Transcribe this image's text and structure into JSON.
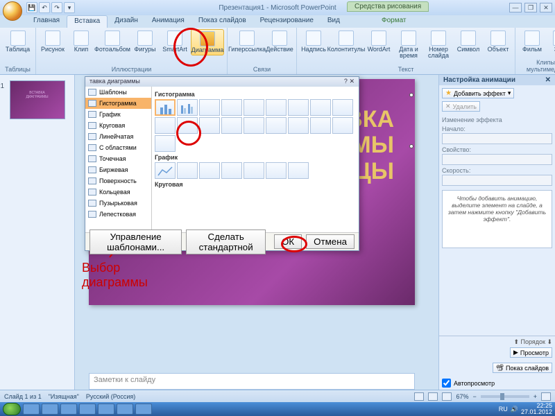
{
  "titlebar": {
    "title": "Презентация1 - Microsoft PowerPoint",
    "context_tab": "Средства рисования"
  },
  "tabs": {
    "home": "Главная",
    "insert": "Вставка",
    "design": "Дизайн",
    "anim": "Анимация",
    "show": "Показ слайдов",
    "review": "Рецензирование",
    "view": "Вид",
    "format": "Формат"
  },
  "ribbon": {
    "tables": {
      "btn": "Таблица",
      "group": "Таблицы"
    },
    "illus": {
      "picture": "Рисунок",
      "clip": "Клип",
      "album": "Фотоальбом",
      "shapes": "Фигуры",
      "smartart": "SmartArt",
      "chart": "Диаграмма",
      "group": "Иллюстрации"
    },
    "links": {
      "hyperlink": "Гиперссылка",
      "action": "Действие",
      "group": "Связи"
    },
    "text": {
      "textbox": "Надпись",
      "header": "Колонтитулы",
      "wordart": "WordArt",
      "date": "Дата и время",
      "slidenum": "Номер слайда",
      "symbol": "Символ",
      "object": "Объект",
      "group": "Текст"
    },
    "media": {
      "movie": "Фильм",
      "sound": "Звук",
      "group": "Клипы мультимедиа"
    }
  },
  "slide": {
    "title_line1": "ВКА",
    "title_line2": "МЫ",
    "title_line3": "ЦЫ"
  },
  "notes_placeholder": "Заметки к слайду",
  "annotation": {
    "line1": "Выбор",
    "line2": "диаграммы"
  },
  "dialog": {
    "title": "тавка диаграммы",
    "nav": [
      "Шаблоны",
      "Гистограмма",
      "График",
      "Круговая",
      "Линейчатая",
      "С областями",
      "Точечная",
      "Биржевая",
      "Поверхность",
      "Кольцевая",
      "Пузырьковая",
      "Лепестковая"
    ],
    "sections": {
      "histogram": "Гистограмма",
      "line": "График",
      "pie": "Круговая"
    },
    "manage": "Управление шаблонами...",
    "default": "Сделать стандартной",
    "ok": "ОК",
    "cancel": "Отмена"
  },
  "anim_pane": {
    "title": "Настройка анимации",
    "add_effect": "Добавить эффект",
    "remove": "Удалить",
    "change_label": "Изменение эффекта",
    "start_label": "Начало:",
    "property_label": "Свойство:",
    "speed_label": "Скорость:",
    "hint": "Чтобы добавить анимацию, выделите элемент на слайде, а затем нажмите кнопку \"Добавить эффект\".",
    "order": "Порядок",
    "play": "Просмотр",
    "slideshow": "Показ слайдов",
    "autopreview": "Автопросмотр"
  },
  "status": {
    "slide": "Слайд 1 из 1",
    "theme": "\"Изящная\"",
    "lang": "Русский (Россия)",
    "zoom": "67%"
  },
  "tray": {
    "lang": "RU",
    "time": "22:25",
    "date": "27.01.2012"
  }
}
